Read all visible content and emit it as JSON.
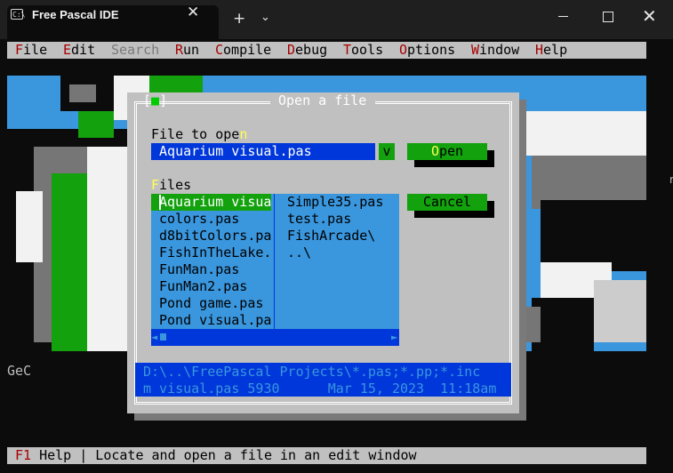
{
  "terminal": {
    "tab_title": "Free Pascal IDE",
    "tab_icon_text": "C:\\",
    "close_glyph": "✕",
    "new_tab_glyph": "+",
    "dropdown_glyph": "⌄",
    "win_close_glyph": "✕"
  },
  "menu": {
    "items": [
      {
        "hot": "F",
        "rest": "ile"
      },
      {
        "hot": "E",
        "rest": "dit"
      },
      {
        "hot": "",
        "rest": "Search",
        "disabled": true
      },
      {
        "hot": "R",
        "rest": "un"
      },
      {
        "hot": "C",
        "rest": "ompile"
      },
      {
        "hot": "D",
        "rest": "ebug"
      },
      {
        "hot": "T",
        "rest": "ools"
      },
      {
        "hot": "O",
        "rest": "ptions"
      },
      {
        "hot": "W",
        "rest": "indow"
      },
      {
        "hot": "H",
        "rest": "elp"
      }
    ]
  },
  "dialog": {
    "close_box_left": "[",
    "close_box_mark": "■",
    "close_box_right": "]",
    "title": "Open a file",
    "file_label_pre": "File to ope",
    "file_label_hot": "n",
    "file_value": " Aquarium visual.pas",
    "history_btn": "v",
    "open_hot": "O",
    "open_rest": "pen",
    "cancel_label": "Cancel",
    "files_label_hot": "F",
    "files_label_rest": "iles",
    "files_col1": [
      "Aquarium visua",
      "colors.pas",
      "d8bitColors.pa",
      "FishInTheLake.",
      "FunMan.pas",
      "FunMan2.pas",
      "Pond game.pas",
      "Pond visual.pa"
    ],
    "files_col2": [
      "Simple35.pas",
      "test.pas",
      "FishArcade\\",
      "..\\"
    ],
    "scroll_left": "◄",
    "scroll_right": "►",
    "info_path": "D:\\..\\FreePascal Projects\\*.pas;*.pp;*.inc",
    "info_file": "m visual.pas 5930      Mar 15, 2023  11:18am"
  },
  "desktop": {
    "side_text": "GeC",
    "edge_glyph": "r"
  },
  "status": {
    "key": "F1",
    "text": " Help | Locate and open a file in an edit window"
  },
  "colors": {
    "menubar": "#c0c0c0",
    "hotkey": "#a80000",
    "input_bg": "#0037da",
    "button_green": "#13a10e",
    "list_bg": "#3a96dd",
    "desktop_blue": "#3a96dd"
  }
}
